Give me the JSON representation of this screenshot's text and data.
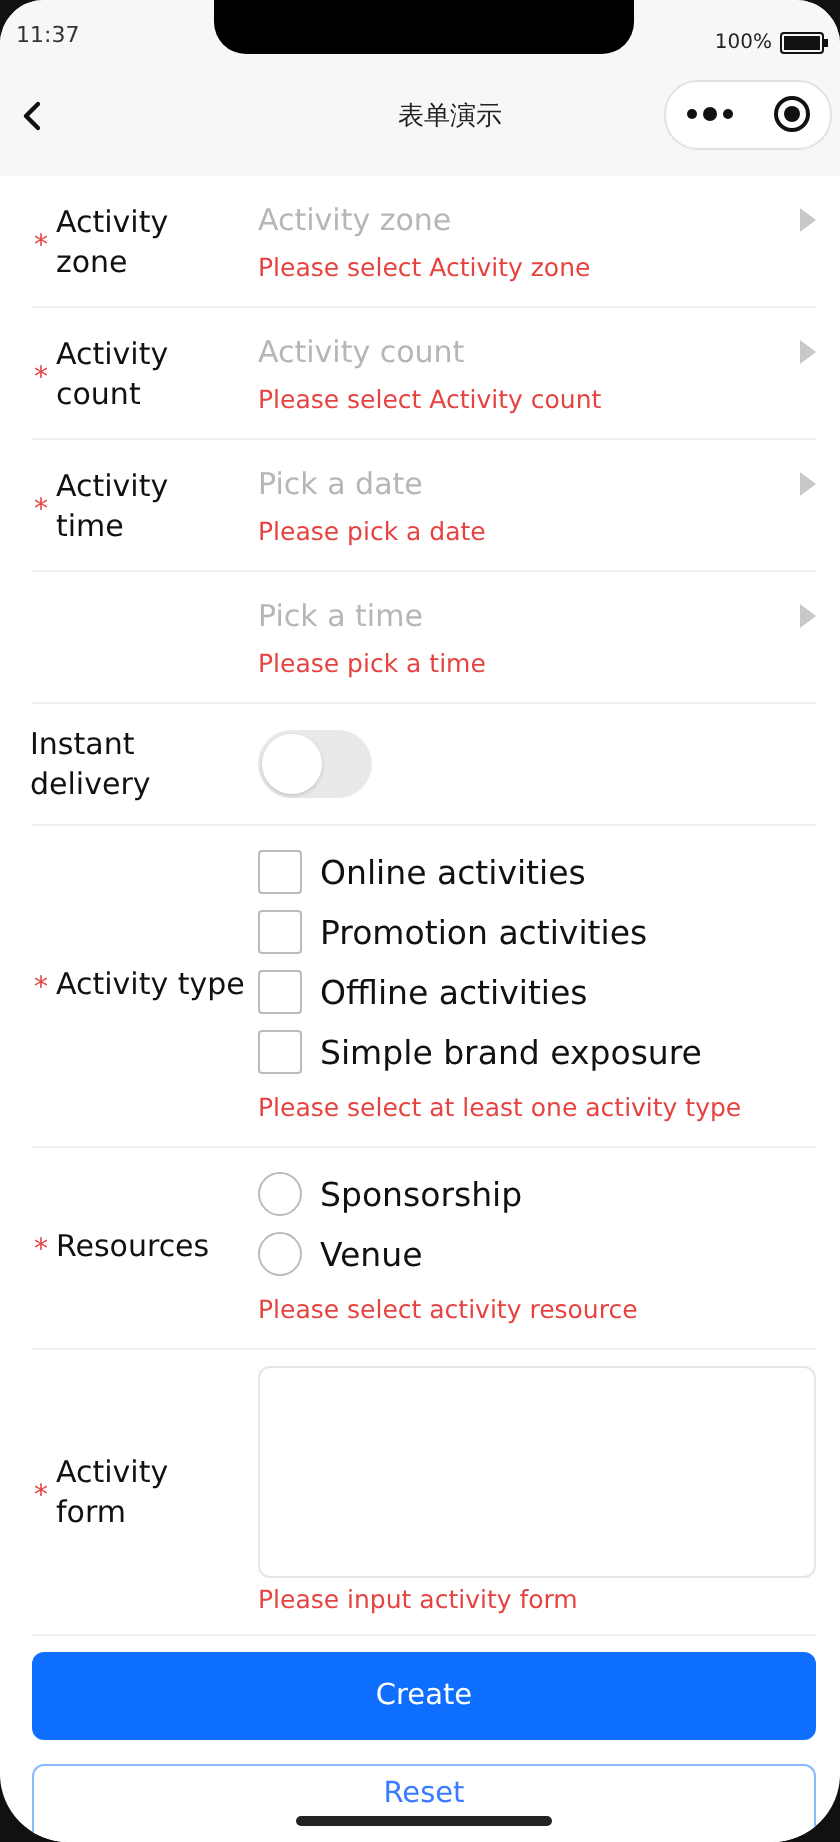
{
  "status_bar": {
    "time": "11:37",
    "battery": "100%"
  },
  "nav": {
    "title": "表单演示"
  },
  "fields": [
    {
      "kind": "picker",
      "required_mark": "*",
      "label": "Activity zone",
      "placeholder": "Activity zone",
      "error": "Please select Activity zone"
    },
    {
      "kind": "picker",
      "required_mark": "*",
      "label": "Activity count",
      "placeholder": "Activity count",
      "error": "Please select Activity count"
    },
    {
      "kind": "picker",
      "required_mark": "*",
      "label": "Activity time",
      "placeholder": "Pick a date",
      "error": "Please pick a date"
    },
    {
      "kind": "picker",
      "placeholder": "Pick a time",
      "error": "Please pick a time"
    },
    {
      "kind": "switch",
      "label": "Instant delivery",
      "on": false
    },
    {
      "kind": "checkbox",
      "required_mark": "*",
      "label": "Activity type",
      "options": [
        {
          "label": "Online activities",
          "checked": false
        },
        {
          "label": "Promotion activities",
          "checked": false
        },
        {
          "label": "Offline activities",
          "checked": false
        },
        {
          "label": "Simple brand exposure",
          "checked": false
        }
      ],
      "error": "Please select at least one activity type"
    },
    {
      "kind": "radio",
      "required_mark": "*",
      "label": "Resources",
      "options": [
        {
          "label": "Sponsorship",
          "selected": false
        },
        {
          "label": "Venue",
          "selected": false
        }
      ],
      "error": "Please select activity resource"
    },
    {
      "kind": "textarea",
      "required_mark": "*",
      "label": "Activity form",
      "error": "Please input activity form"
    }
  ],
  "buttons": [
    {
      "kind": "primary",
      "label": "Create"
    },
    {
      "kind": "outline",
      "label": "Reset"
    }
  ]
}
